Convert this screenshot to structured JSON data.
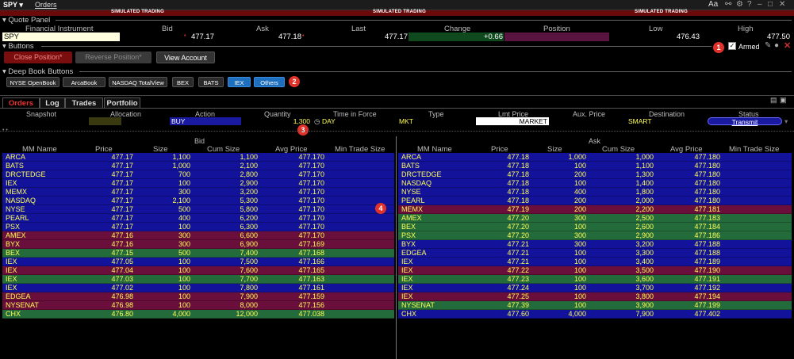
{
  "titlebar": {
    "symbol": "SPY ▾",
    "orders": "Orders",
    "aa": "Aa"
  },
  "sim_label": "SIMULATED TRADING",
  "quote_panel": {
    "title": "Quote Panel",
    "headers": {
      "instrument": "Financial Instrument",
      "bid": "Bid",
      "ask": "Ask",
      "last": "Last",
      "change": "Change",
      "position": "Position",
      "low": "Low",
      "high": "High"
    },
    "symbol": "SPY",
    "bid": "477.17",
    "ask": "477.18",
    "last": "477.17",
    "change": "+0.66",
    "position": "",
    "low": "476.43",
    "high": "477.50"
  },
  "buttons_panel": {
    "title": "Buttons",
    "close_position": "Close Position*",
    "reverse_position": "Reverse Position*",
    "view_account": "View Account",
    "armed": "Armed"
  },
  "deep_book": {
    "title": "Deep Book Buttons",
    "items": [
      "NYSE OpenBook",
      "ArcaBook",
      "NASDAQ TotalView",
      "BEX",
      "BATS",
      "IEX",
      "Others"
    ]
  },
  "markers": [
    "1",
    "2",
    "3",
    "4"
  ],
  "tabs": [
    "Orders",
    "Log",
    "Trades",
    "Portfolio"
  ],
  "order_entry": {
    "headers": {
      "snapshot": "Snapshot",
      "allocation": "Allocation",
      "action": "Action",
      "quantity": "Quantity",
      "tif": "Time in Force",
      "type": "Type",
      "lmt_price": "Lmt Price",
      "aux_price": "Aux. Price",
      "destination": "Destination",
      "status": "Status"
    },
    "action": "BUY",
    "quantity": "1,300",
    "tif": "DAY",
    "type": "MKT",
    "lmt_price": "MARKET",
    "destination": "SMART",
    "status": "Transmit"
  },
  "book": {
    "bid_title": "Bid",
    "ask_title": "Ask",
    "columns": [
      "MM Name",
      "Price",
      "Size",
      "Cum Size",
      "Avg Price",
      "Min Trade Size"
    ],
    "colors": {
      "blue": "#12129a",
      "maroon": "#6a0e3c",
      "green": "#236b3a",
      "yellow": "#ffff55"
    },
    "bid_rows": [
      {
        "mm": "ARCA",
        "price": "477.17",
        "size": "1,100",
        "cum": "1,100",
        "avg": "477.170",
        "bg": "blue"
      },
      {
        "mm": "BATS",
        "price": "477.17",
        "size": "1,000",
        "cum": "2,100",
        "avg": "477.170",
        "bg": "blue"
      },
      {
        "mm": "DRCTEDGE",
        "price": "477.17",
        "size": "700",
        "cum": "2,800",
        "avg": "477.170",
        "bg": "blue"
      },
      {
        "mm": "IEX",
        "price": "477.17",
        "size": "100",
        "cum": "2,900",
        "avg": "477.170",
        "bg": "blue"
      },
      {
        "mm": "MEMX",
        "price": "477.17",
        "size": "300",
        "cum": "3,200",
        "avg": "477.170",
        "bg": "blue"
      },
      {
        "mm": "NASDAQ",
        "price": "477.17",
        "size": "2,100",
        "cum": "5,300",
        "avg": "477.170",
        "bg": "blue"
      },
      {
        "mm": "NYSE",
        "price": "477.17",
        "size": "500",
        "cum": "5,800",
        "avg": "477.170",
        "bg": "blue"
      },
      {
        "mm": "PEARL",
        "price": "477.17",
        "size": "400",
        "cum": "6,200",
        "avg": "477.170",
        "bg": "blue"
      },
      {
        "mm": "PSX",
        "price": "477.17",
        "size": "100",
        "cum": "6,300",
        "avg": "477.170",
        "bg": "blue"
      },
      {
        "mm": "AMEX",
        "price": "477.16",
        "size": "300",
        "cum": "6,600",
        "avg": "477.170",
        "bg": "maroon"
      },
      {
        "mm": "BYX",
        "price": "477.16",
        "size": "300",
        "cum": "6,900",
        "avg": "477.169",
        "bg": "maroon"
      },
      {
        "mm": "BEX",
        "price": "477.15",
        "size": "500",
        "cum": "7,400",
        "avg": "477.168",
        "bg": "green"
      },
      {
        "mm": "IEX",
        "price": "477.05",
        "size": "100",
        "cum": "7,500",
        "avg": "477.166",
        "bg": "blue"
      },
      {
        "mm": "IEX",
        "price": "477.04",
        "size": "100",
        "cum": "7,600",
        "avg": "477.165",
        "bg": "maroon"
      },
      {
        "mm": "IEX",
        "price": "477.03",
        "size": "100",
        "cum": "7,700",
        "avg": "477.163",
        "bg": "green"
      },
      {
        "mm": "IEX",
        "price": "477.02",
        "size": "100",
        "cum": "7,800",
        "avg": "477.161",
        "bg": "blue"
      },
      {
        "mm": "EDGEA",
        "price": "476.98",
        "size": "100",
        "cum": "7,900",
        "avg": "477.159",
        "bg": "maroon"
      },
      {
        "mm": "NYSENAT",
        "price": "476.98",
        "size": "100",
        "cum": "8,000",
        "avg": "477.156",
        "bg": "maroon"
      },
      {
        "mm": "CHX",
        "price": "476.80",
        "size": "4,000",
        "cum": "12,000",
        "avg": "477.038",
        "bg": "green"
      }
    ],
    "ask_rows": [
      {
        "mm": "ARCA",
        "price": "477.18",
        "size": "1,000",
        "cum": "1,000",
        "avg": "477.180",
        "bg": "blue"
      },
      {
        "mm": "BATS",
        "price": "477.18",
        "size": "100",
        "cum": "1,100",
        "avg": "477.180",
        "bg": "blue"
      },
      {
        "mm": "DRCTEDGE",
        "price": "477.18",
        "size": "200",
        "cum": "1,300",
        "avg": "477.180",
        "bg": "blue"
      },
      {
        "mm": "NASDAQ",
        "price": "477.18",
        "size": "100",
        "cum": "1,400",
        "avg": "477.180",
        "bg": "blue"
      },
      {
        "mm": "NYSE",
        "price": "477.18",
        "size": "400",
        "cum": "1,800",
        "avg": "477.180",
        "bg": "blue"
      },
      {
        "mm": "PEARL",
        "price": "477.18",
        "size": "200",
        "cum": "2,000",
        "avg": "477.180",
        "bg": "blue"
      },
      {
        "mm": "MEMX",
        "price": "477.19",
        "size": "200",
        "cum": "2,200",
        "avg": "477.181",
        "bg": "maroon"
      },
      {
        "mm": "AMEX",
        "price": "477.20",
        "size": "300",
        "cum": "2,500",
        "avg": "477.183",
        "bg": "green"
      },
      {
        "mm": "BEX",
        "price": "477.20",
        "size": "100",
        "cum": "2,600",
        "avg": "477.184",
        "bg": "green"
      },
      {
        "mm": "PSX",
        "price": "477.20",
        "size": "300",
        "cum": "2,900",
        "avg": "477.186",
        "bg": "green"
      },
      {
        "mm": "BYX",
        "price": "477.21",
        "size": "300",
        "cum": "3,200",
        "avg": "477.188",
        "bg": "blue"
      },
      {
        "mm": "EDGEA",
        "price": "477.21",
        "size": "100",
        "cum": "3,300",
        "avg": "477.188",
        "bg": "blue"
      },
      {
        "mm": "IEX",
        "price": "477.21",
        "size": "100",
        "cum": "3,400",
        "avg": "477.189",
        "bg": "blue"
      },
      {
        "mm": "IEX",
        "price": "477.22",
        "size": "100",
        "cum": "3,500",
        "avg": "477.190",
        "bg": "maroon"
      },
      {
        "mm": "IEX",
        "price": "477.23",
        "size": "100",
        "cum": "3,600",
        "avg": "477.191",
        "bg": "green"
      },
      {
        "mm": "IEX",
        "price": "477.24",
        "size": "100",
        "cum": "3,700",
        "avg": "477.192",
        "bg": "blue"
      },
      {
        "mm": "IEX",
        "price": "477.25",
        "size": "100",
        "cum": "3,800",
        "avg": "477.194",
        "bg": "maroon"
      },
      {
        "mm": "NYSENAT",
        "price": "477.39",
        "size": "100",
        "cum": "3,900",
        "avg": "477.199",
        "bg": "green"
      },
      {
        "mm": "CHX",
        "price": "477.60",
        "size": "4,000",
        "cum": "7,900",
        "avg": "477.402",
        "bg": "blue"
      }
    ]
  }
}
